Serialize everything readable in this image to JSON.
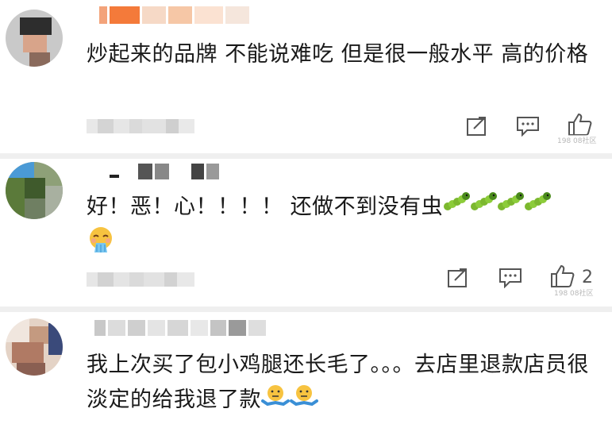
{
  "comments": [
    {
      "text": "炒起来的品牌 不能说难吃 但是很一般水平 高的价格",
      "like_count": "",
      "watermark": "198 08社区"
    },
    {
      "text": "好！恶！心！！！！ 还做不到没有虫",
      "emojis": [
        "caterpillar",
        "caterpillar",
        "caterpillar",
        "caterpillar",
        "vomiting-face"
      ],
      "like_count": "2",
      "watermark": "198 08社区"
    },
    {
      "text": "我上次买了包小鸡腿还长毛了。。。去店里退款店员很淡定的给我退了款",
      "emojis": [
        "shrug-face",
        "shrug-face"
      ],
      "like_count": ""
    }
  ],
  "icons": {
    "share": "share-icon",
    "comment": "comment-icon",
    "like": "thumbs-up-icon"
  },
  "colors": {
    "text": "#1a1a1a",
    "icon": "#555555",
    "separator": "#efefef"
  }
}
